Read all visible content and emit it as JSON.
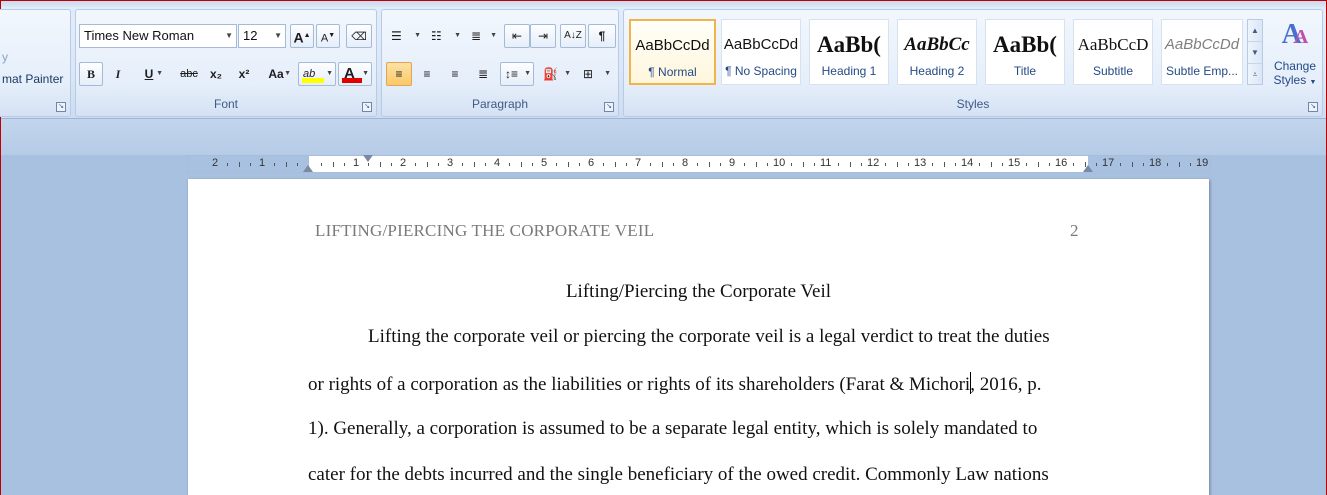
{
  "clipboard": {
    "frag1": "y",
    "frag2": "mat Painter"
  },
  "font_group": {
    "label": "Font",
    "font_name": "Times New Roman",
    "font_size": "12",
    "grow": "A",
    "shrink": "A",
    "bold": "B",
    "italic": "I",
    "underline": "U",
    "strike": "abc",
    "subscript": "x₂",
    "superscript": "x²",
    "change_case": "Aa",
    "highlight": "ab",
    "font_color": "A",
    "highlight_color": "#ffff00",
    "font_color_value": "#e00000"
  },
  "paragraph_group": {
    "label": "Paragraph"
  },
  "styles_group": {
    "label": "Styles",
    "tiles": [
      {
        "preview": "AaBbCcDd",
        "name": "¶ Normal"
      },
      {
        "preview": "AaBbCcDd",
        "name": "¶ No Spacing"
      },
      {
        "preview": "AaBb(",
        "name": "Heading 1"
      },
      {
        "preview": "AaBbCc",
        "name": "Heading 2"
      },
      {
        "preview": "AaBb(",
        "name": "Title"
      },
      {
        "preview": "AaBbCcD",
        "name": "Subtitle"
      },
      {
        "preview": "AaBbCcDd",
        "name": "Subtle Emp..."
      }
    ],
    "change_styles_line1": "Change",
    "change_styles_line2": "Styles"
  },
  "ruler": {
    "left_numbers": [
      "2",
      "1"
    ],
    "numbers": [
      "1",
      "2",
      "3",
      "4",
      "5",
      "6",
      "7",
      "8",
      "9",
      "10",
      "11",
      "12",
      "13",
      "14",
      "15",
      "16",
      "17",
      "18",
      "19"
    ]
  },
  "document": {
    "running_head": "LIFTING/PIERCING  THE  CORPORATE  VEIL",
    "page_number": "2",
    "title": "Lifting/Piercing the Corporate Veil",
    "line1": "Lifting the corporate veil or piercing the corporate veil is a legal verdict to treat the duties",
    "line2a": "or rights of a corporation as the liabilities or rights of its shareholders (Farat & Michori",
    "line2b": ", 2016, p.",
    "line3": "1). Generally, a corporation is assumed to be a separate legal entity, which is solely mandated to",
    "line4": "cater for the debts incurred and the single beneficiary of the owed credit. Commonly Law nations"
  }
}
